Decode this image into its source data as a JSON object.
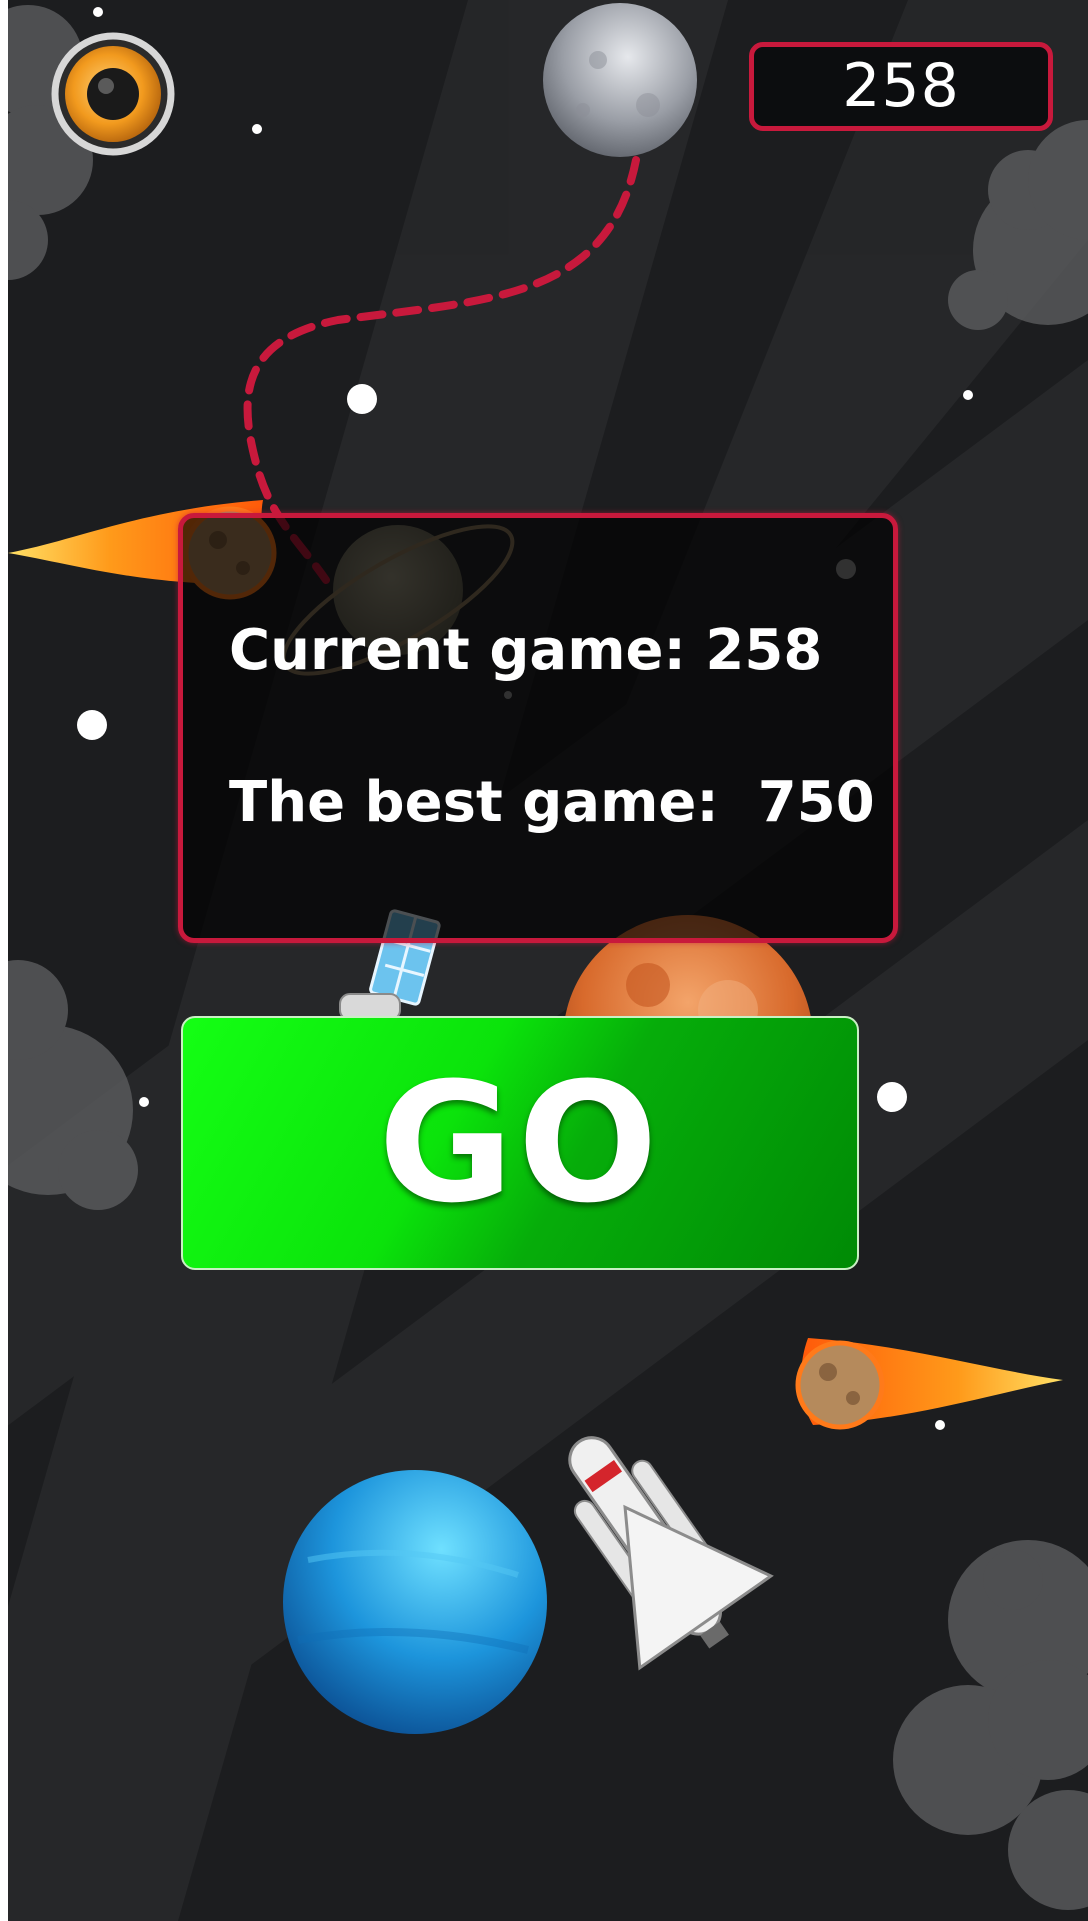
{
  "hud": {
    "score": "258",
    "sound_icon": "speaker-icon"
  },
  "results": {
    "current_game": "Current game: 258",
    "best_game": "The best game:  750"
  },
  "go_button": {
    "label": "GO"
  },
  "colors": {
    "accent": "#c8193c",
    "go_green_light": "#14ff14",
    "go_green_dark": "#008a05",
    "background": "#1c1d1f"
  },
  "decorations": [
    "moon-icon",
    "saturn-icon",
    "mars-icon",
    "neptune-icon",
    "comet-icon",
    "satellite-icon",
    "space-shuttle-icon",
    "cloud-icon",
    "star-icon"
  ]
}
